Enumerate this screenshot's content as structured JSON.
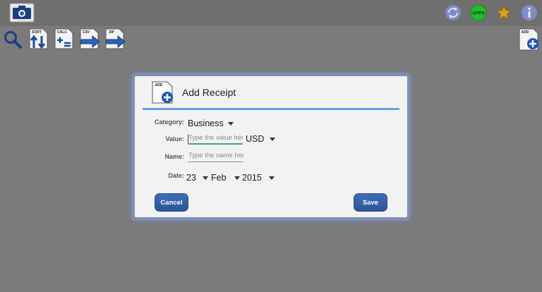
{
  "topbar": {
    "icons": [
      "camera-app-icon",
      "sync-icon",
      "apps-icon",
      "star-icon",
      "info-icon"
    ],
    "apps_label": "APPS"
  },
  "toolbar": {
    "sort_label": "SORT",
    "calc_label": "CALC",
    "csv_label": "CSV",
    "zip_label": "ZIP",
    "add_label": "ADD"
  },
  "dialog": {
    "title": "Add Receipt",
    "icon_label": "ADD",
    "category": {
      "label": "Category:",
      "value": "Business"
    },
    "value": {
      "label": "Value:",
      "placeholder": "Type the value here",
      "currency": "USD"
    },
    "name": {
      "label": "Name:",
      "placeholder": "Type the name here"
    },
    "date": {
      "label": "Date:",
      "day": "23",
      "month": "Feb",
      "year": "2015"
    },
    "cancel_label": "Cancel",
    "save_label": "Save"
  },
  "colors": {
    "accent_rule": "#6b9ce8",
    "button": "#2f5ea6",
    "active_underline": "#36a3a3",
    "apps_green": "#1fbf2a"
  }
}
